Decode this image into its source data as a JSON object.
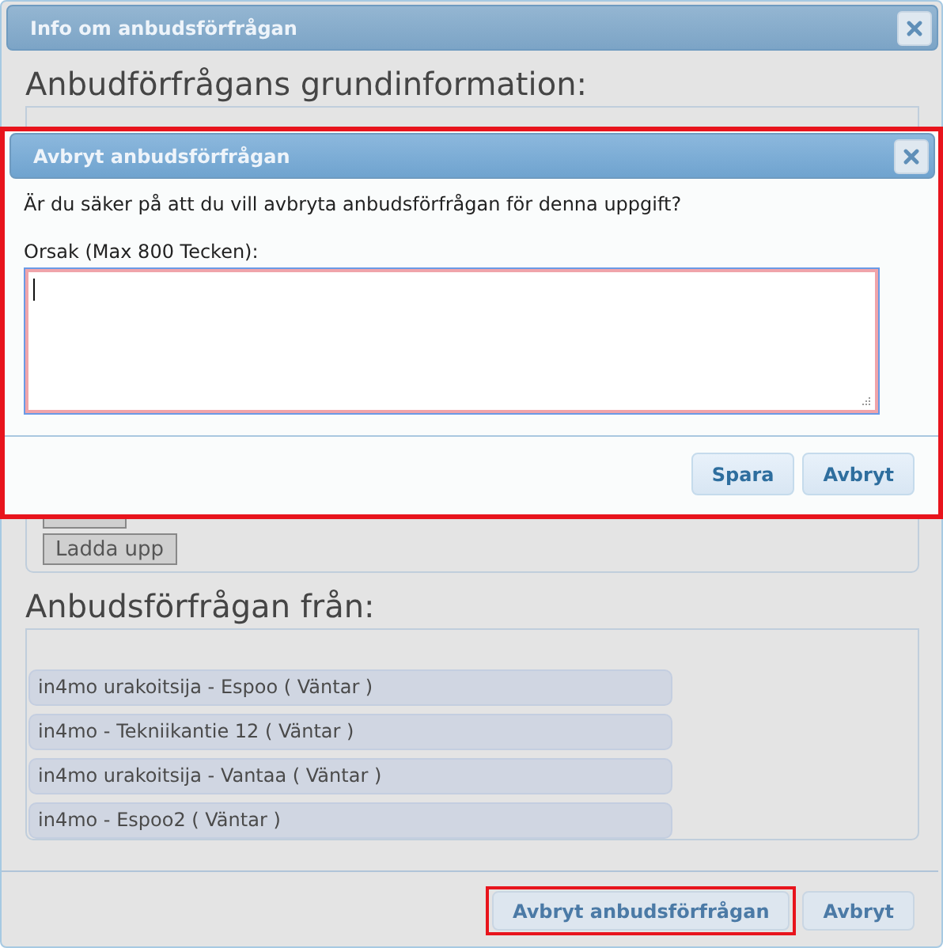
{
  "window": {
    "title": "Info om anbudsförfrågan"
  },
  "basic_info": {
    "heading": "Anbudförfrågans grundinformation:",
    "upload_button": "Ladda upp"
  },
  "requests_from": {
    "heading": "Anbudsförfrågan från:",
    "items": [
      {
        "label": "in4mo urakoitsija - Espoo ( Väntar )"
      },
      {
        "label": "in4mo - Tekniikantie 12 ( Väntar )"
      },
      {
        "label": "in4mo urakoitsija - Vantaa ( Väntar )"
      },
      {
        "label": "in4mo - Espoo2 ( Väntar )"
      }
    ]
  },
  "footer_buttons": [
    {
      "label": "Avbryt anbudsförfrågan",
      "highlighted": true
    },
    {
      "label": "Avbryt",
      "highlighted": false
    }
  ],
  "dialog": {
    "title": "Avbryt anbudsförfrågan",
    "highlighted": true,
    "question": "Är du säker på att du vill avbryta anbudsförfrågan för denna uppgift?",
    "reason_label": "Orsak (Max 800 Tecken):",
    "reason_field": {
      "focused": true
    },
    "buttons": [
      {
        "label": "Spara"
      },
      {
        "label": "Avbryt"
      }
    ]
  }
}
